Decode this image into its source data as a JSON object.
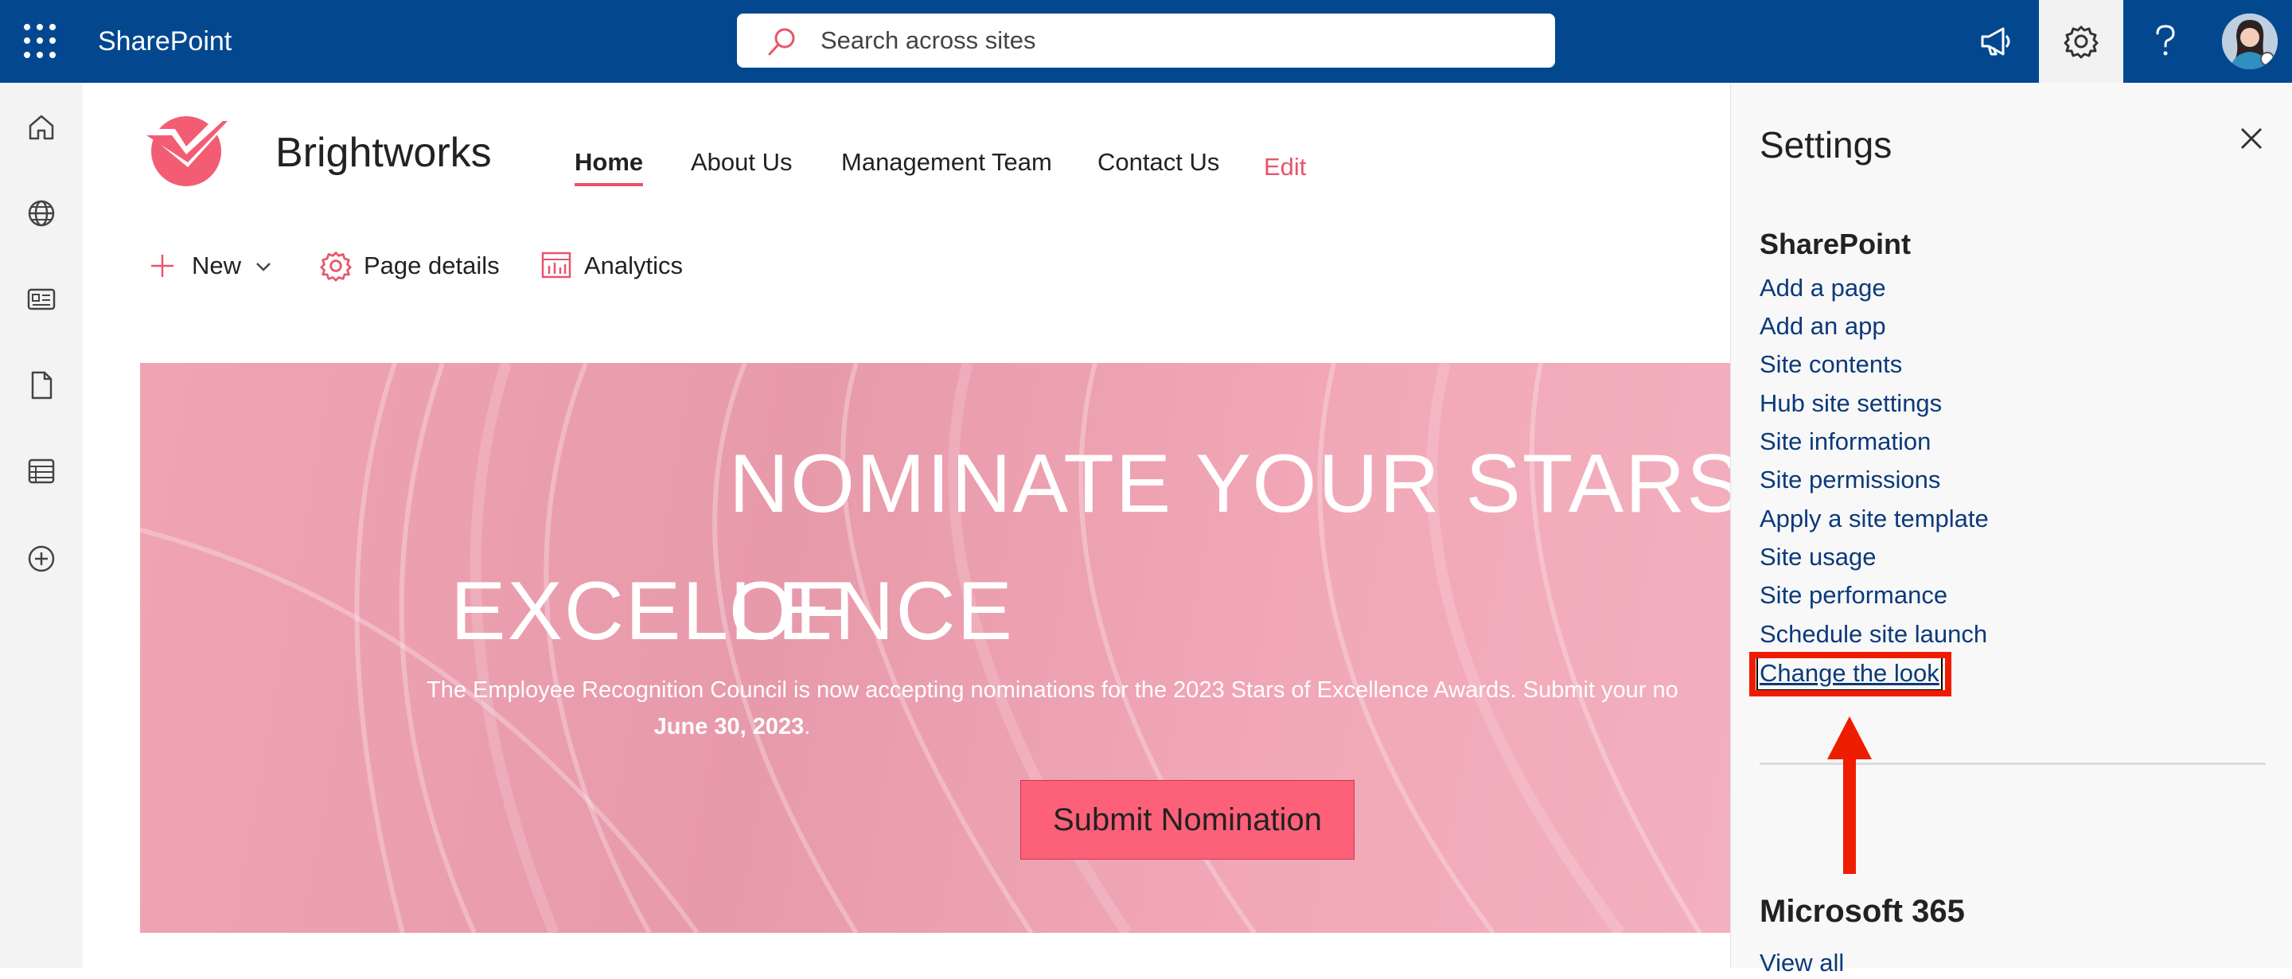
{
  "topbar": {
    "app_name": "SharePoint",
    "search_placeholder": "Search across sites",
    "icons": [
      "app-launcher-icon",
      "megaphone-icon",
      "gear-icon",
      "help-icon",
      "avatar"
    ],
    "colors": {
      "bar": "#03488f",
      "accent": "#e8556c"
    }
  },
  "left_rail": {
    "icons": [
      "home-icon",
      "globe-icon",
      "news-icon",
      "file-icon",
      "list-icon",
      "add-icon"
    ]
  },
  "site": {
    "name": "Brightworks",
    "nav": [
      "Home",
      "About Us",
      "Management Team",
      "Contact Us"
    ],
    "nav_edit": "Edit"
  },
  "command_bar": {
    "new": "New",
    "page_details": "Page details",
    "analytics": "Analytics"
  },
  "hero": {
    "title_line1": "NOMINATE YOUR STARS OF",
    "title_line2": "EXCELLENCE",
    "text": "The Employee Recognition Council is now accepting nominations for the 2023 Stars of Excellence Awards. Submit your no",
    "date": "June 30, 2023",
    "date_suffix": ".",
    "button": "Submit Nomination"
  },
  "settings_panel": {
    "title": "Settings",
    "sharepoint_section": "SharePoint",
    "links": [
      "Add a page",
      "Add an app",
      "Site contents",
      "Hub site settings",
      "Site information",
      "Site permissions",
      "Apply a site template",
      "Site usage",
      "Site performance",
      "Schedule site launch",
      "Change the look"
    ],
    "m365_section": "Microsoft 365",
    "view_all": "View all"
  },
  "annotation": {
    "highlight_color": "#ee1d00"
  }
}
